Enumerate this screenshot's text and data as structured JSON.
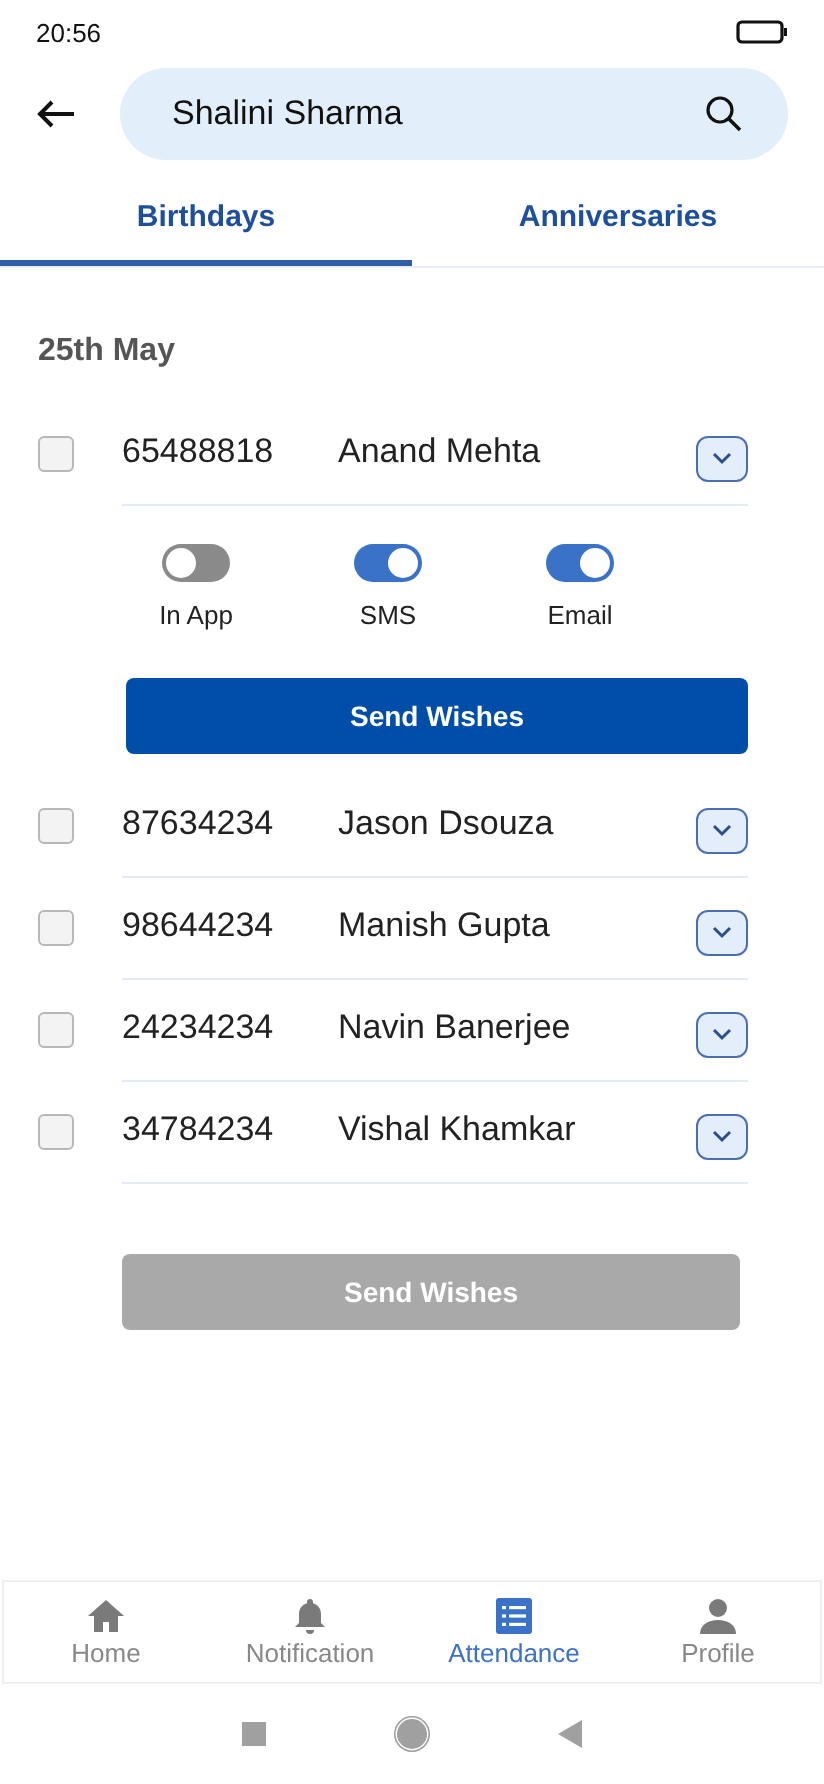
{
  "status_bar": {
    "time": "20:56"
  },
  "search": {
    "value": "Shalini Sharma"
  },
  "tabs": [
    {
      "label": "Birthdays",
      "selected": true
    },
    {
      "label": "Anniversaries",
      "selected": false
    }
  ],
  "date_heading": "25th May",
  "people": [
    {
      "id": "65488818",
      "name": "Anand Mehta",
      "checked": false,
      "channels": [
        {
          "label": "In App",
          "on": false
        },
        {
          "label": "SMS",
          "on": true
        },
        {
          "label": "Email",
          "on": true
        }
      ],
      "button": {
        "label": "Send Wishes",
        "disabled": false
      }
    },
    {
      "id": "87634234",
      "name": "Jason Dsouza",
      "checked": false
    },
    {
      "id": "98644234",
      "name": "Manish Gupta",
      "checked": false
    },
    {
      "id": "24234234",
      "name": "Navin Banerjee",
      "checked": false
    },
    {
      "id": "34784234",
      "name": "Vishal Khamkar",
      "checked": false
    }
  ],
  "send_button": {
    "label": "Send Wishes",
    "disabled": true
  },
  "bottom_nav": [
    {
      "kind": "home",
      "label": "Home",
      "selected": false
    },
    {
      "kind": "bell",
      "label": "Notification",
      "selected": false
    },
    {
      "kind": "list",
      "label": "Attendance",
      "selected": true
    },
    {
      "kind": "person",
      "label": "Profile",
      "selected": false
    }
  ]
}
